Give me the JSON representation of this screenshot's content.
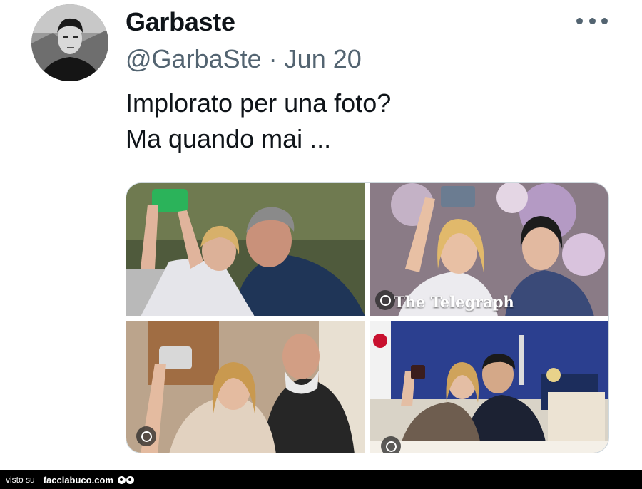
{
  "author": {
    "display_name": "Garbaste",
    "handle": "@GarbaSte",
    "separator": "·",
    "date": "Jun 20",
    "avatar_icon": "profile-photo"
  },
  "tweet": {
    "lines": [
      "Implorato per una foto?",
      "Ma quando mai ..."
    ]
  },
  "media": {
    "tiles": [
      {
        "description_icon": "selfie-photo"
      },
      {
        "description_icon": "selfie-photo",
        "watermark": "The Telegraph"
      },
      {
        "description_icon": "selfie-photo"
      },
      {
        "description_icon": "selfie-photo"
      }
    ]
  },
  "more_menu": {
    "icon": "more-horizontal-icon"
  },
  "footer": {
    "prefix": "visto su",
    "site": "facciabuco.com",
    "colors": {
      "bar": "#000000",
      "text": "#ffffff"
    }
  },
  "colors": {
    "primary_text": "#0f1419",
    "secondary_text": "#536471",
    "border": "#cfd9de"
  }
}
